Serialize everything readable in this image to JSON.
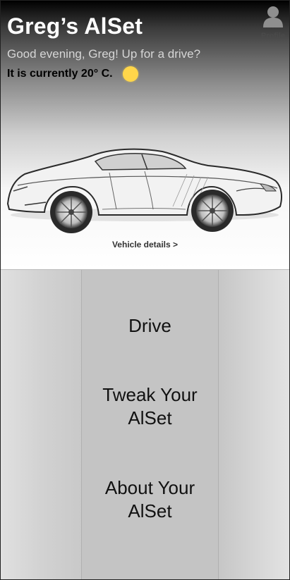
{
  "header": {
    "title": "Greg’s AlSet",
    "greeting": "Good evening, Greg! Up for a drive?",
    "temperature_text": "It is currently 20° C.",
    "weather_icon": "sun-icon",
    "sun_color": "#ffd64a"
  },
  "profile": {
    "label": "Profile",
    "icon": "user-icon"
  },
  "vehicle": {
    "image": "sports-car-sketch",
    "details_link": "Vehicle details >"
  },
  "menu": {
    "drive": "Drive",
    "tweak_line1": "Tweak Your",
    "tweak_line2": "AlSet",
    "about_line1": "About Your",
    "about_line2": "AlSet"
  }
}
